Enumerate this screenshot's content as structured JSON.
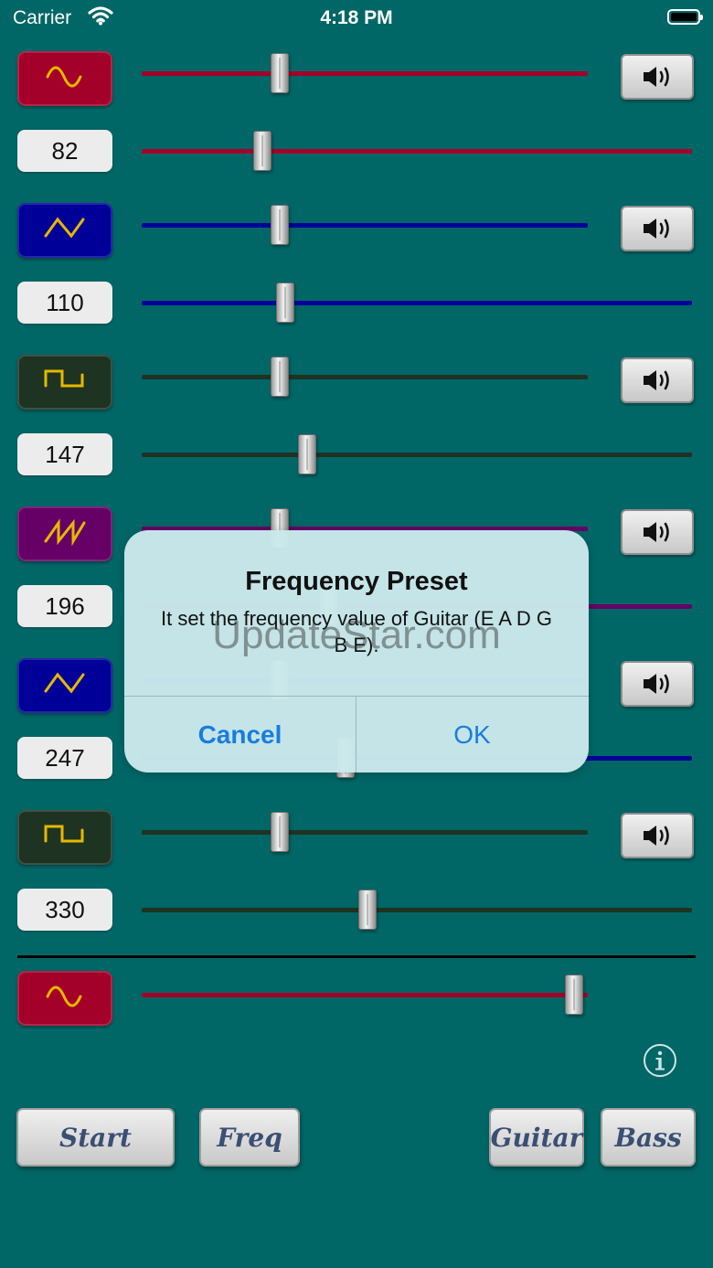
{
  "status_bar": {
    "carrier": "Carrier",
    "time": "4:18 PM"
  },
  "colors": {
    "background": "#006666",
    "red": "#a3002a",
    "blue": "#000099",
    "dark": "#1f3322",
    "purple": "#660066",
    "wave_glyph": "#e6b800",
    "link_blue": "#1a7cdc"
  },
  "channels": [
    {
      "wave": "sine",
      "wave_icon": "sine-wave-icon",
      "color": "#a3002a",
      "frequency": "82",
      "volume": 0.31,
      "freq_level": 0.22
    },
    {
      "wave": "triangle",
      "wave_icon": "triangle-wave-icon",
      "color": "#000099",
      "frequency": "110",
      "volume": 0.31,
      "freq_level": 0.26
    },
    {
      "wave": "square",
      "wave_icon": "square-wave-icon",
      "color": "#1f3322",
      "frequency": "147",
      "volume": 0.31,
      "freq_level": 0.3
    },
    {
      "wave": "sawtooth",
      "wave_icon": "sawtooth-wave-icon",
      "color": "#660066",
      "frequency": "196",
      "volume": 0.31,
      "freq_level": 0.34
    },
    {
      "wave": "triangle",
      "wave_icon": "triangle-wave-icon",
      "color": "#000099",
      "frequency": "247",
      "volume": 0.31,
      "freq_level": 0.37
    },
    {
      "wave": "square",
      "wave_icon": "square-wave-icon",
      "color": "#1f3322",
      "frequency": "330",
      "volume": 0.31,
      "freq_level": 0.41
    }
  ],
  "master": {
    "wave": "sine",
    "wave_icon": "sine-wave-icon",
    "color": "#a3002a",
    "level": 0.97
  },
  "buttons": {
    "start": "Start",
    "freq": "Freq",
    "guitar": "Guitar",
    "bass": "Bass"
  },
  "dialog": {
    "title": "Frequency Preset",
    "message": "It set the frequency value of Guitar (E A D G B E).",
    "cancel": "Cancel",
    "ok": "OK"
  },
  "watermark": "UpdateStar.com"
}
